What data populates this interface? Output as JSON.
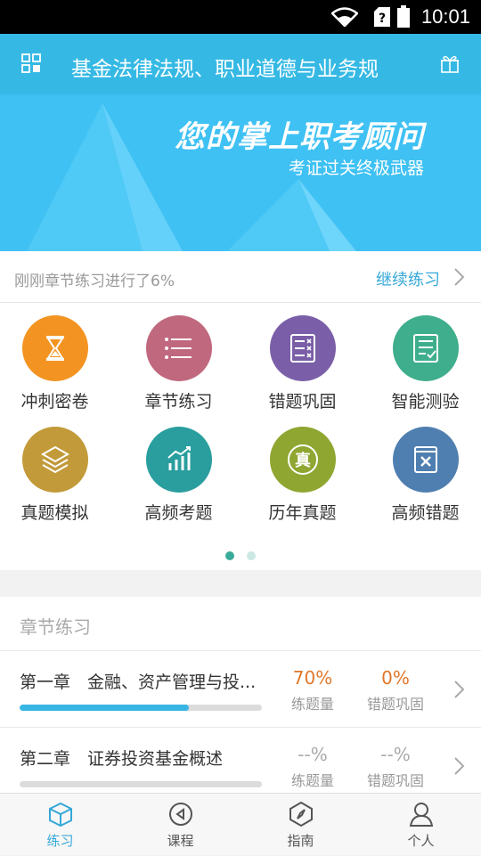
{
  "status_bar": {
    "time": "10:01",
    "icons": [
      "wifi-icon",
      "sim-unknown-icon",
      "battery-icon"
    ]
  },
  "header": {
    "title": "基金法律法规、职业道德与业务规",
    "left_icon": "apps-grid-icon",
    "right_icon": "gift-icon",
    "bg_color": "#35b9e4"
  },
  "banner": {
    "headline": "您的掌上职考顾问",
    "subtitle": "考证过关终极武器",
    "bg_color": "#3fc1f3"
  },
  "progress_notice": {
    "text": "刚刚章节练习进行了6%",
    "action": "继续练习"
  },
  "feature_grid": {
    "page": 1,
    "pages": 2,
    "items": [
      {
        "label": "冲刺密卷",
        "icon": "hourglass-icon",
        "color": "#f39422"
      },
      {
        "label": "章节练习",
        "icon": "list-icon",
        "color": "#c0687e"
      },
      {
        "label": "错题巩固",
        "icon": "wrong-list-icon",
        "color": "#7a5fa8"
      },
      {
        "label": "智能测验",
        "icon": "smart-test-icon",
        "color": "#3fae8c"
      },
      {
        "label": "真题模拟",
        "icon": "layers-icon",
        "color": "#c29a3a"
      },
      {
        "label": "高频考题",
        "icon": "chart-icon",
        "color": "#2a9e9e"
      },
      {
        "label": "历年真题",
        "icon": "zhen-badge-icon",
        "color": "#8fa631"
      },
      {
        "label": "高频错题",
        "icon": "wrong-book-icon",
        "color": "#4f7fb0"
      }
    ]
  },
  "chapter_section": {
    "title": "章节练习",
    "chapters": [
      {
        "name": "第一章　金融、资产管理与投...",
        "progress": 0.7,
        "practice_value": "70%",
        "practice_label": "练题量",
        "practice_color": "#e0782a",
        "wrong_value": "0%",
        "wrong_label": "错题巩固",
        "wrong_color": "#e0782a"
      },
      {
        "name": "第二章　证券投资基金概述",
        "progress": 0,
        "practice_value": "--%",
        "practice_label": "练题量",
        "practice_color": "#aaaaaa",
        "wrong_value": "--%",
        "wrong_label": "错题巩固",
        "wrong_color": "#aaaaaa"
      }
    ]
  },
  "bottom_nav": {
    "active_index": 0,
    "active_color": "#35a8d8",
    "inactive_color": "#555555",
    "tabs": [
      {
        "label": "练习",
        "icon": "cube-icon"
      },
      {
        "label": "课程",
        "icon": "play-icon"
      },
      {
        "label": "指南",
        "icon": "compass-icon"
      },
      {
        "label": "个人",
        "icon": "person-icon"
      }
    ]
  }
}
